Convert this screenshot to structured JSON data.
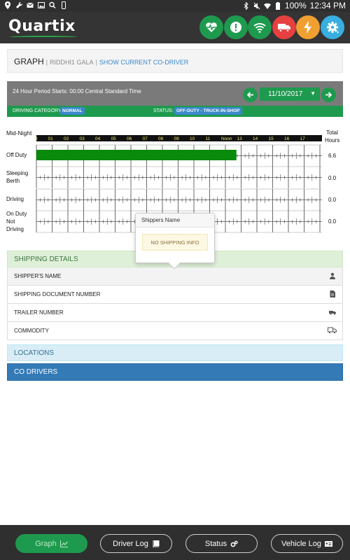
{
  "status_bar": {
    "battery": "100%",
    "time": "12:34 PM"
  },
  "app": {
    "logo": "Quartix",
    "header_buttons": [
      {
        "icon": "heartbeat-icon",
        "color": "#1e9a4e"
      },
      {
        "icon": "alert-icon",
        "color": "#1e9a4e"
      },
      {
        "icon": "wifi-icon",
        "color": "#1e9a4e"
      },
      {
        "icon": "truck-icon",
        "color": "#e64040"
      },
      {
        "icon": "lightning-icon",
        "color": "#f0a030"
      },
      {
        "icon": "gear-icon",
        "color": "#3aaee0"
      }
    ]
  },
  "title_panel": {
    "title": "GRAPH",
    "separator": "|",
    "driver": "RIDDHI1 GALA",
    "co_driver_link": "SHOW CURRENT CO-DRIVER"
  },
  "period": {
    "text": "24 Hour Period Starts: 00:00 Central Standard Time",
    "date": "11/10/2017",
    "driving_category_label": "DRIVING CATEGORY:",
    "driving_category": "NORMAL",
    "status_label": "STATUS:",
    "status": "OFF-DUTY - TRUCK-IN-SHOP"
  },
  "log_graph": {
    "midnight_label": "Mid-Night",
    "total_label_line1": "Total",
    "total_label_line2": "Hours",
    "hour_labels": [
      "0",
      "01",
      "02",
      "03",
      "04",
      "05",
      "06",
      "07",
      "08",
      "09",
      "10",
      "11",
      "Noon",
      "13",
      "14",
      "15",
      "16",
      "17"
    ],
    "rows": [
      {
        "label_lines": [
          "Off Duty"
        ],
        "total": "6.6"
      },
      {
        "label_lines": [
          "Sleeping",
          "Berth"
        ],
        "total": "0.0"
      },
      {
        "label_lines": [
          "Driving"
        ],
        "total": "0.0"
      },
      {
        "label_lines": [
          "On Duty",
          "Not",
          "Driving"
        ],
        "total": "0.0"
      }
    ],
    "segments": [
      {
        "row": 0,
        "start_hour": 0,
        "end_hour": 12.7
      }
    ],
    "segment_color": "#0a8a0a"
  },
  "popover": {
    "title": "Shippers Name",
    "message": "NO SHIPPING INFO"
  },
  "shipping": {
    "header": "SHIPPING DETAILS",
    "rows": [
      {
        "label": "SHIPPER'S NAME",
        "icon": "user-icon"
      },
      {
        "label": "SHIPPING DOCUMENT NUMBER",
        "icon": "document-icon"
      },
      {
        "label": "TRAILER NUMBER",
        "icon": "truck-icon"
      },
      {
        "label": "COMMODITY",
        "icon": "boxes-icon"
      }
    ]
  },
  "locations_header": "LOCATIONS",
  "co_drivers_header": "CO DRIVERS",
  "bottom_nav": {
    "graph": "Graph",
    "driver_log": "Driver Log",
    "status": "Status",
    "vehicle_log": "Vehicle Log"
  }
}
